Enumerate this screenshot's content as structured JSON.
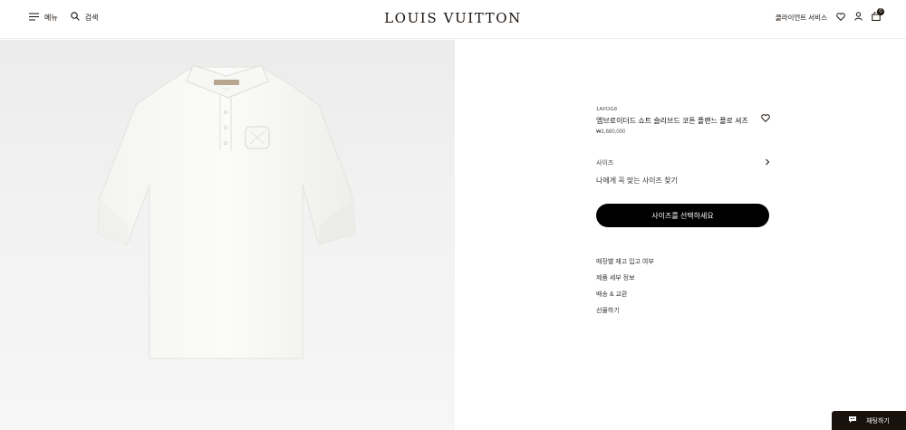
{
  "header": {
    "menu_label": "메뉴",
    "search_label": "검색",
    "brand": "LOUIS VUITTON",
    "client_service": "클라이언트 서비스",
    "cart_count": "0"
  },
  "product": {
    "sku": "1AFDG8",
    "title": "엠브로이더드 쇼트 슬리브드 코튼 플랜느 폴로 셔츠",
    "price": "₩1,680,000",
    "size_label": "사이즈",
    "size_guide": "나에게 꼭 맞는 사이즈 찾기",
    "select_button": "사이즈를 선택하세요"
  },
  "links": [
    "매장별 재고 입고 여부",
    "제품 세부 정보",
    "배송 & 교환",
    "선물하기"
  ],
  "chat": {
    "label": "채팅하기"
  },
  "icons": {
    "menu": "hamburger-icon",
    "search": "search-icon",
    "wishlist": "heart-icon",
    "account": "user-icon",
    "cart": "bag-icon",
    "chat": "chat-bubble-icon"
  }
}
